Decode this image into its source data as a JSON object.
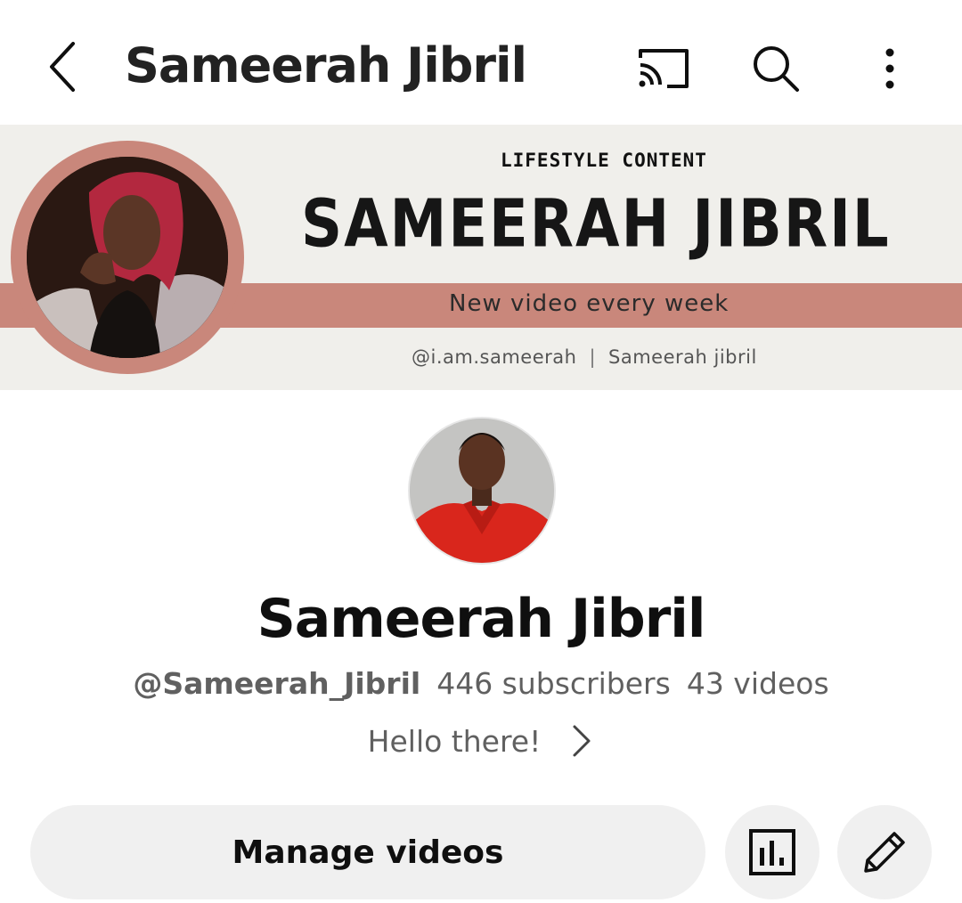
{
  "topbar": {
    "title": "Sameerah Jibril",
    "icons": [
      "back-arrow-icon",
      "cast-icon",
      "search-icon",
      "more-vertical-icon"
    ]
  },
  "banner": {
    "kicker": "LIFESTYLE CONTENT",
    "name": "SAMEERAH JIBRIL",
    "tagline": "New video every week",
    "handle_instagram": "@i.am.sameerah",
    "separator": "|",
    "handle_youtube": "Sameerah jibril",
    "colors": {
      "background": "#f0efeb",
      "accent": "#c9877b"
    }
  },
  "channel": {
    "name": "Sameerah Jibril",
    "handle": "@Sameerah_Jibril",
    "subscribers": "446 subscribers",
    "videos": "43 videos",
    "description": "Hello there!"
  },
  "actions": {
    "manage_videos_label": "Manage videos",
    "icons": [
      "analytics-icon",
      "pencil-edit-icon"
    ]
  }
}
